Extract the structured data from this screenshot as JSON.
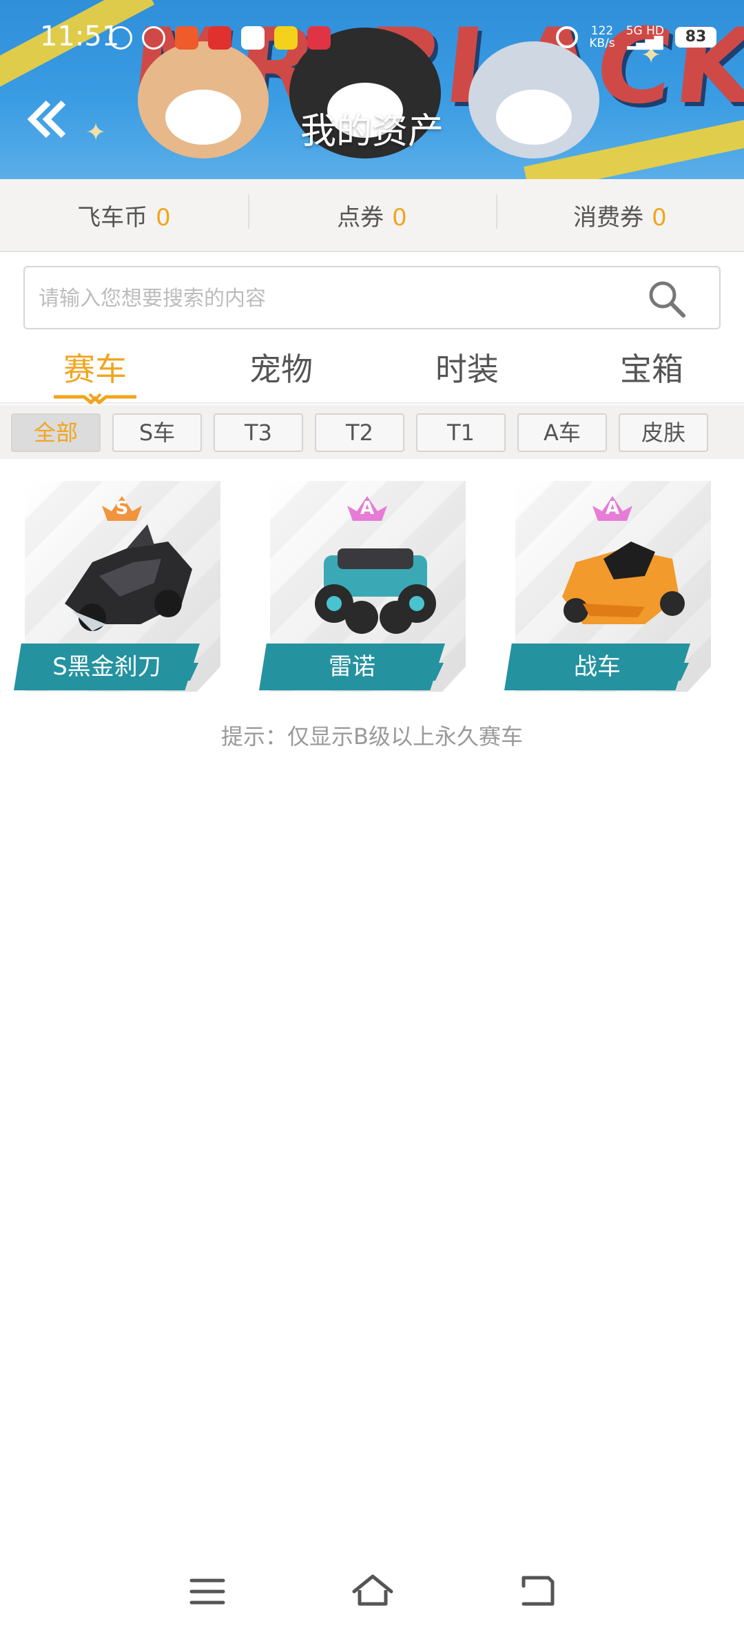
{
  "status_bar": {
    "time": "11:51",
    "net_speed": "122",
    "net_unit": "KB/s",
    "network": "5G HD",
    "battery": "83"
  },
  "header": {
    "title": "我的资产",
    "banner_text": "MR.BLACK"
  },
  "currencies": [
    {
      "label": "飞车币",
      "value": "0"
    },
    {
      "label": "点券",
      "value": "0"
    },
    {
      "label": "消费券",
      "value": "0"
    }
  ],
  "search": {
    "placeholder": "请输入您想要搜索的内容"
  },
  "tabs": [
    {
      "label": "赛车",
      "active": true
    },
    {
      "label": "宠物",
      "active": false
    },
    {
      "label": "时装",
      "active": false
    },
    {
      "label": "宝箱",
      "active": false
    }
  ],
  "filters": [
    {
      "label": "全部",
      "active": true
    },
    {
      "label": "S车",
      "active": false
    },
    {
      "label": "T3",
      "active": false
    },
    {
      "label": "T2",
      "active": false
    },
    {
      "label": "T1",
      "active": false
    },
    {
      "label": "A车",
      "active": false
    },
    {
      "label": "皮肤",
      "active": false
    }
  ],
  "cars": [
    {
      "name": "S黑金刹刀",
      "grade": "S",
      "grade_color": "#f08a2a",
      "body_color": "#2b2b2e"
    },
    {
      "name": "雷诺",
      "grade": "A",
      "grade_color": "#e46fd3",
      "body_color": "#3aa9b5"
    },
    {
      "name": "战车",
      "grade": "A",
      "grade_color": "#e46fd3",
      "body_color": "#f29a2c"
    }
  ],
  "hint": "提示：仅显示B级以上永久赛车",
  "colors": {
    "accent": "#f0a51f",
    "label_bg": "#2592a0",
    "header_bg": "#3a9ce3"
  }
}
